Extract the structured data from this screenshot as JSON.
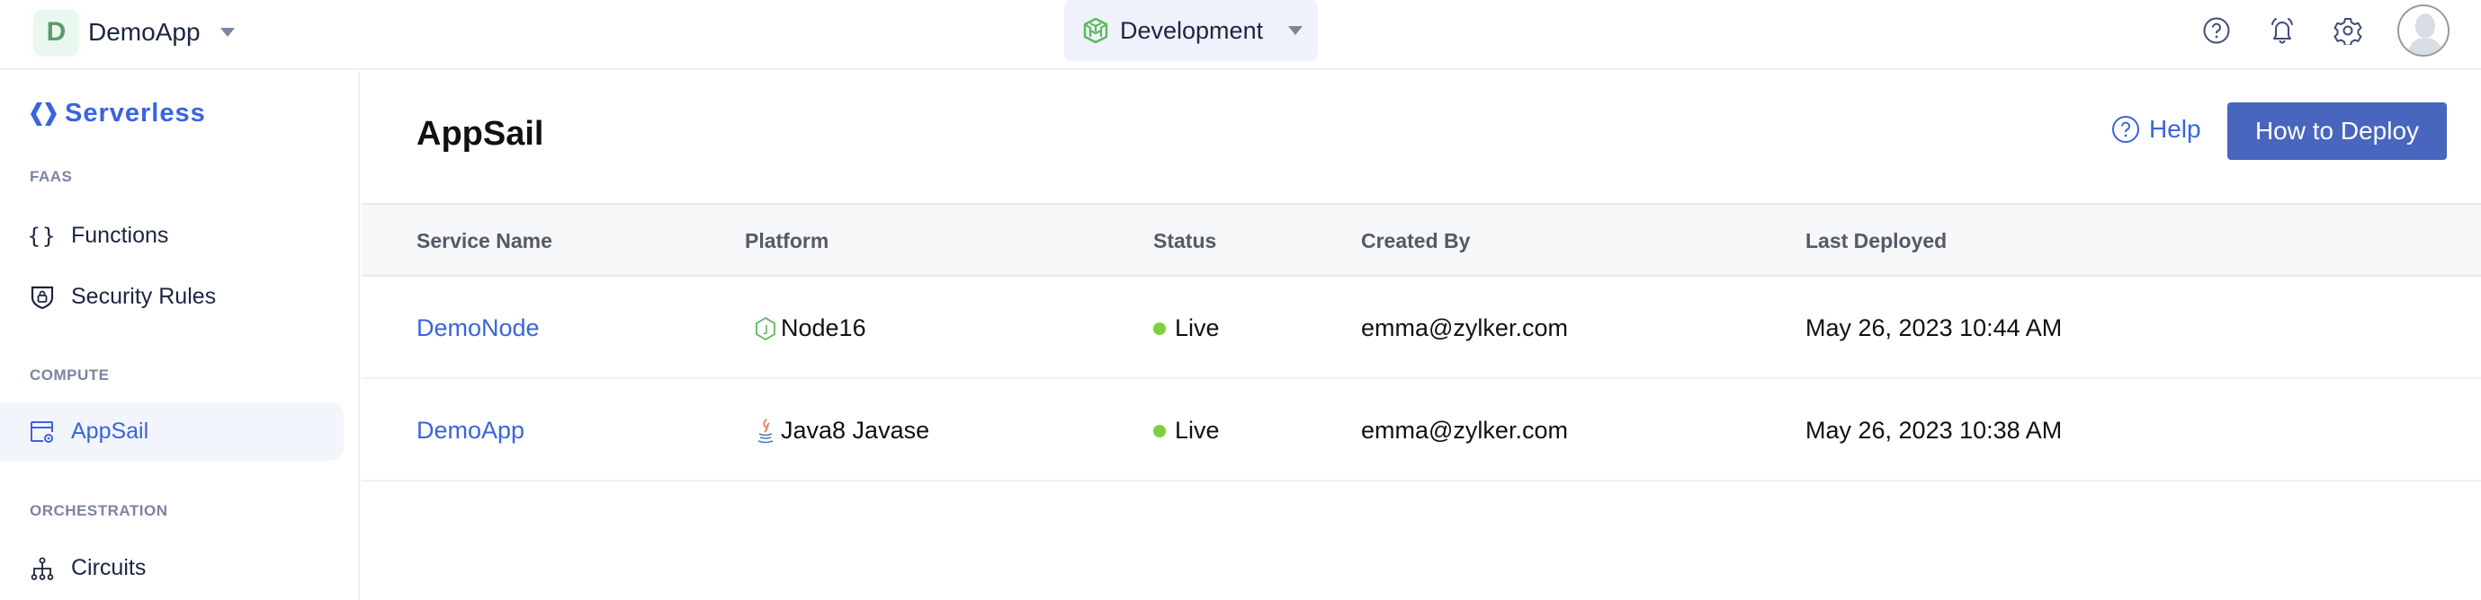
{
  "topbar": {
    "app_initial": "D",
    "app_name": "DemoApp",
    "environment": "Development",
    "icons": [
      "help-icon",
      "bell-icon",
      "gear-icon",
      "avatar"
    ]
  },
  "sidebar": {
    "brand": "Serverless",
    "sections": [
      {
        "label": "FAAS",
        "items": [
          {
            "label": "Functions",
            "icon": "braces-icon",
            "active": false
          },
          {
            "label": "Security Rules",
            "icon": "shield-lock-icon",
            "active": false
          }
        ]
      },
      {
        "label": "COMPUTE",
        "items": [
          {
            "label": "AppSail",
            "icon": "window-gear-icon",
            "active": true
          }
        ]
      },
      {
        "label": "ORCHESTRATION",
        "items": [
          {
            "label": "Circuits",
            "icon": "hierarchy-icon",
            "active": false
          }
        ]
      }
    ]
  },
  "main": {
    "title": "AppSail",
    "help_label": "Help",
    "deploy_button": "How to Deploy",
    "table": {
      "columns": [
        "Service Name",
        "Platform",
        "Status",
        "Created By",
        "Last Deployed"
      ],
      "rows": [
        {
          "service": "DemoNode",
          "platform": "Node16",
          "platform_icon": "nodejs-icon",
          "status": "Live",
          "created_by": "emma@zylker.com",
          "last_deployed": "May 26, 2023 10:44 AM"
        },
        {
          "service": "DemoApp",
          "platform": "Java8 Javase",
          "platform_icon": "java-icon",
          "status": "Live",
          "created_by": "emma@zylker.com",
          "last_deployed": "May 26, 2023 10:38 AM"
        }
      ]
    }
  },
  "colors": {
    "accent": "#3a63de",
    "button": "#4866bd",
    "status_live": "#7ed03e",
    "env_icon": "#5cb85c"
  }
}
